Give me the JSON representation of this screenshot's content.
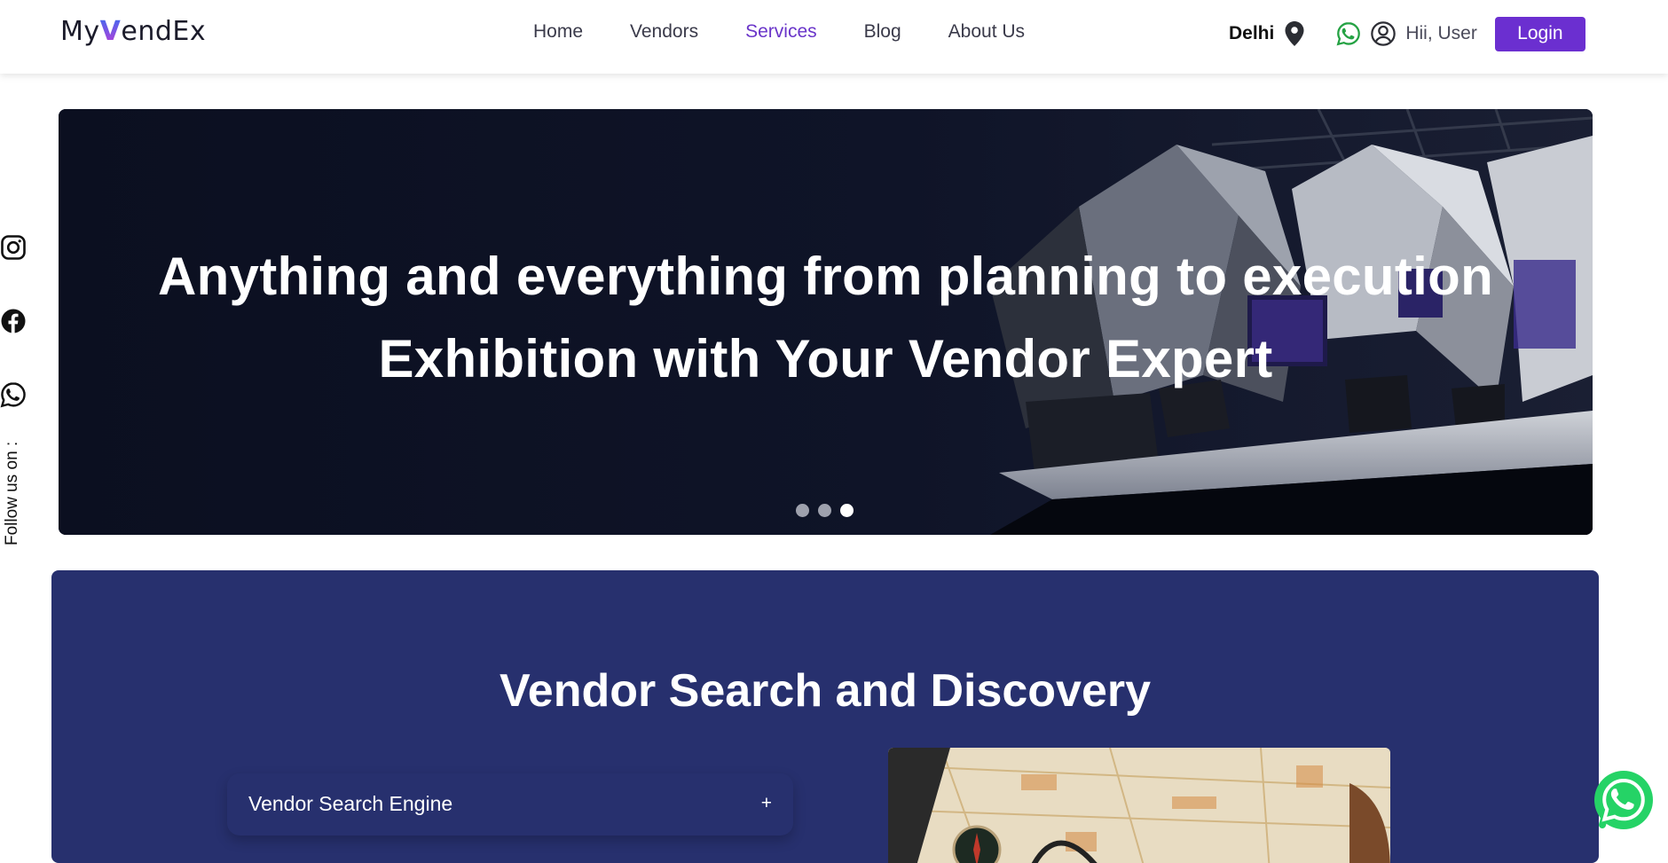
{
  "brand": {
    "logo_prefix": "My",
    "logo_v": "V",
    "logo_suffix": "endEx"
  },
  "nav": {
    "items": [
      {
        "label": "Home"
      },
      {
        "label": "Vendors"
      },
      {
        "label": "Services",
        "active": true
      },
      {
        "label": "Blog"
      },
      {
        "label": "About Us"
      }
    ]
  },
  "header": {
    "city": "Delhi",
    "greeting": "Hii, User",
    "login_label": "Login"
  },
  "social": {
    "follow_label": "Follow us on :",
    "icons": [
      "instagram-icon",
      "facebook-icon",
      "whatsapp-icon"
    ]
  },
  "hero": {
    "line1": "Anything and everything from planning to execution",
    "line2": "Exhibition with Your Vendor Expert",
    "slides_total": 3,
    "active_slide": 3
  },
  "discovery": {
    "title": "Vendor Search and Discovery",
    "accordion": [
      {
        "label": "Vendor Search Engine",
        "toggle": "+"
      }
    ]
  },
  "colors": {
    "accent": "#6b2fd0",
    "section_bg": "#27306e",
    "hero_bg": "#0c1022",
    "whatsapp": "#25d366"
  }
}
